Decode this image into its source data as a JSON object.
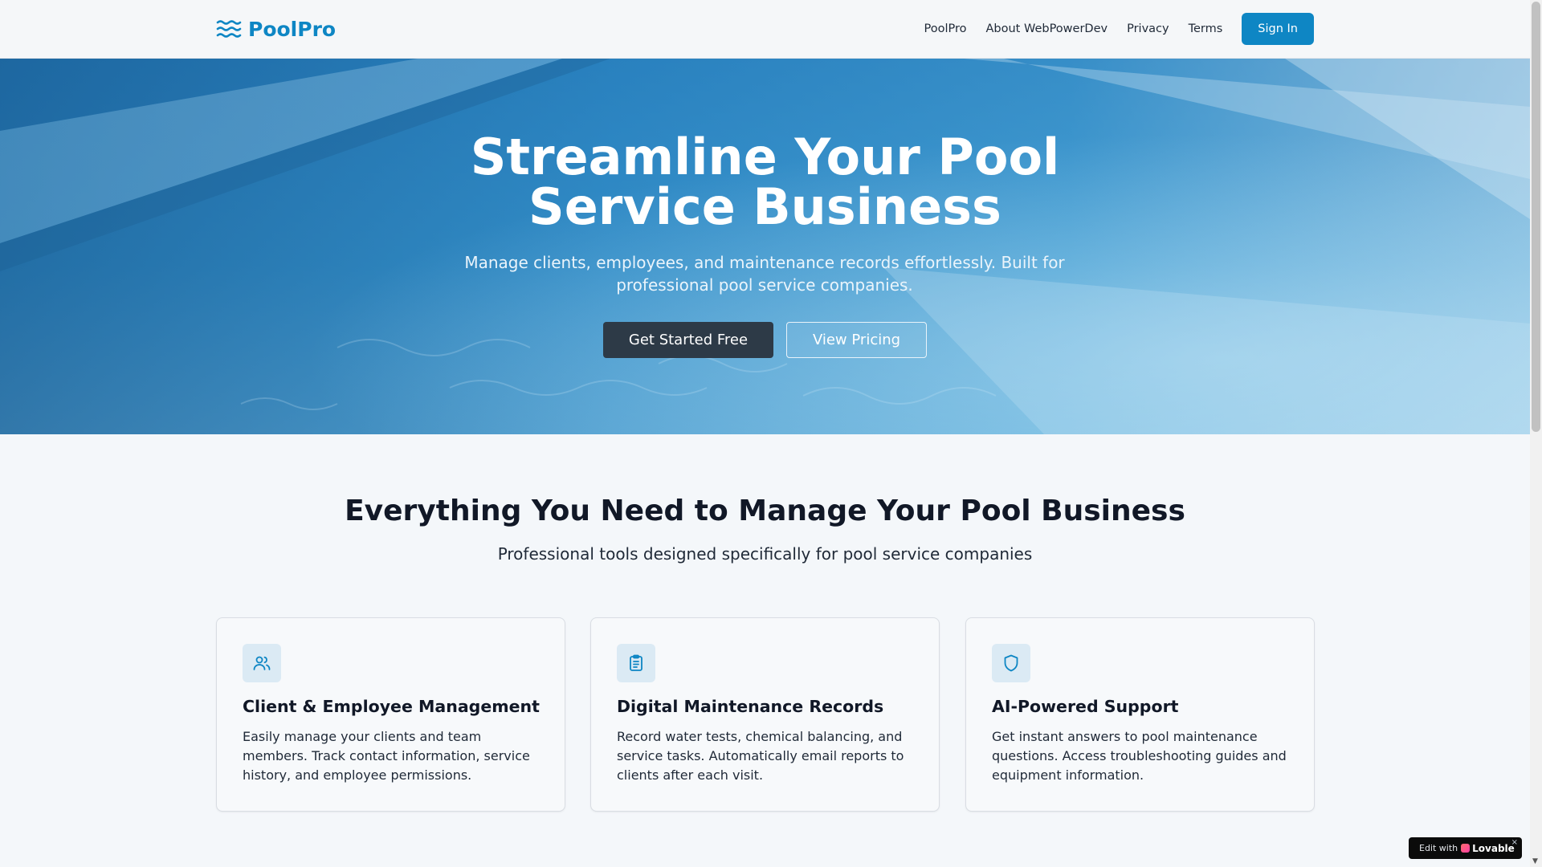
{
  "nav": {
    "brand": "PoolPro",
    "links": [
      "PoolPro",
      "About WebPowerDev",
      "Privacy",
      "Terms"
    ],
    "signin_label": "Sign In"
  },
  "hero": {
    "title_line1": "Streamline Your Pool",
    "title_line2": "Service Business",
    "subtitle": "Manage clients, employees, and maintenance records effortlessly. Built for professional pool service companies.",
    "primary_cta": "Get Started Free",
    "secondary_cta": "View Pricing"
  },
  "features": {
    "title": "Everything You Need to Manage Your Pool Business",
    "subtitle": "Professional tools designed specifically for pool service companies",
    "cards": [
      {
        "icon": "users-icon",
        "title": "Client & Employee Management",
        "description": "Easily manage your clients and team members. Track contact information, service history, and employee permissions."
      },
      {
        "icon": "clipboard-icon",
        "title": "Digital Maintenance Records",
        "description": "Record water tests, chemical balancing, and service tasks. Automatically email reports to clients after each visit."
      },
      {
        "icon": "shield-icon",
        "title": "AI-Powered Support",
        "description": "Get instant answers to pool maintenance questions. Access troubleshooting guides and equipment information."
      }
    ]
  },
  "badge": {
    "prefix": "Edit with",
    "brand": "Lovable",
    "close": "×"
  },
  "colors": {
    "accent": "#0e86c4",
    "dark_button": "#2d3a47",
    "icon_bg": "#dbeaf4"
  }
}
